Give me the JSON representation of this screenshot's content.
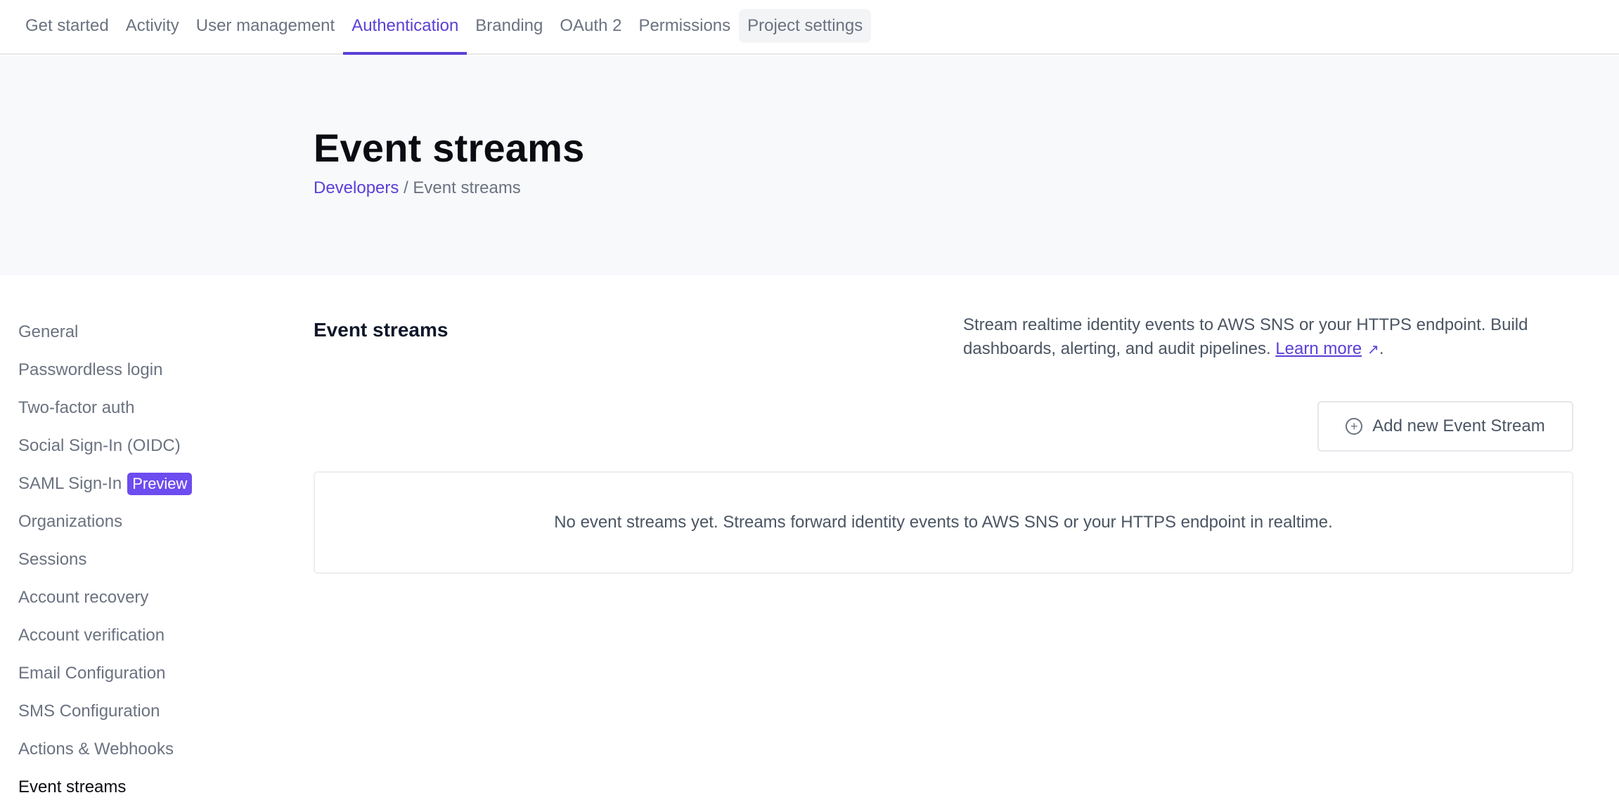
{
  "topnav": {
    "tabs": [
      {
        "label": "Get started"
      },
      {
        "label": "Activity"
      },
      {
        "label": "User management"
      },
      {
        "label": "Authentication"
      },
      {
        "label": "Branding"
      },
      {
        "label": "OAuth 2"
      },
      {
        "label": "Permissions"
      },
      {
        "label": "Project settings"
      }
    ],
    "active_tab": "Authentication",
    "accent_color": "#5b3fd6"
  },
  "hero": {
    "title": "Event streams",
    "breadcrumb": {
      "parent": "Developers",
      "separator": "/",
      "current": "Event streams"
    }
  },
  "sidebar": {
    "items": [
      {
        "label": "General"
      },
      {
        "label": "Passwordless login"
      },
      {
        "label": "Two-factor auth"
      },
      {
        "label": "Social Sign-In (OIDC)"
      },
      {
        "label": "SAML Sign-In",
        "badge": "Preview"
      },
      {
        "label": "Organizations"
      },
      {
        "label": "Sessions"
      },
      {
        "label": "Account recovery"
      },
      {
        "label": "Account verification"
      },
      {
        "label": "Email Configuration"
      },
      {
        "label": "SMS Configuration"
      },
      {
        "label": "Actions & Webhooks"
      },
      {
        "label": "Event streams"
      }
    ],
    "current_item": "Event streams",
    "badge_color": "#6d4cf0"
  },
  "main": {
    "section_title": "Event streams",
    "description": "Stream realtime identity events to AWS SNS or your HTTPS endpoint. Build dashboards, alerting, and audit pipelines.",
    "learn_more": "Learn more",
    "learn_more_icon": "external-link-arrow-icon",
    "trailing_period": ".",
    "add_button_label": "Add new Event Stream",
    "add_button_icon": "plus-circle-icon",
    "empty_message": "No event streams yet. Streams forward identity events to AWS SNS or your HTTPS endpoint in realtime."
  }
}
